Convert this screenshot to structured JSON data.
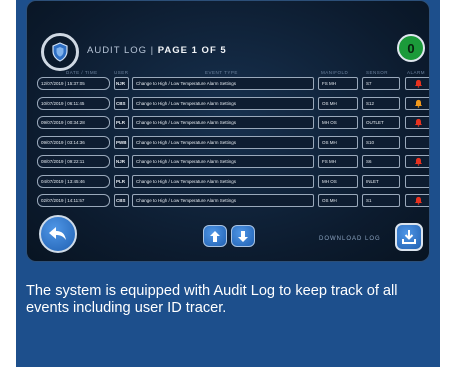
{
  "header": {
    "title_prefix": "AUDIT LOG",
    "separator": "|",
    "page_label": "PAGE 1 OF 5",
    "alert_count": "0"
  },
  "columns": {
    "datetime": "DATE / TIME",
    "user": "USER",
    "event": "EVENT TYPE",
    "manifold": "MANIFOLD",
    "sensor": "SENSOR",
    "alarm": "ALARM"
  },
  "rows": [
    {
      "datetime": "12/07/2019 | 15:37:05",
      "user": "NJR",
      "event": "Change to High / Low Temperature Alarm Settings",
      "manifold": "FS MH",
      "sensor": "S7",
      "alarm": true
    },
    {
      "datetime": "10/07/2019 | 06:11:45",
      "user": "CBS",
      "event": "Change to High / Low Temperature Alarm Settings",
      "manifold": "OS MH",
      "sensor": "S12",
      "alarm": true
    },
    {
      "datetime": "09/07/2019 | 00:34:28",
      "user": "PLR",
      "event": "Change to High / Low Temperature Alarm Settings",
      "manifold": "MH OS",
      "sensor": "OUTLET",
      "alarm": true
    },
    {
      "datetime": "09/07/2019 | 03:14:36",
      "user": "PWB",
      "event": "Change to High / Low Temperature Alarm Settings",
      "manifold": "OS MH",
      "sensor": "S10",
      "alarm": false
    },
    {
      "datetime": "08/07/2019 | 09:22:11",
      "user": "NJR",
      "event": "Change to High / Low Temperature Alarm Settings",
      "manifold": "FS MH",
      "sensor": "S6",
      "alarm": true
    },
    {
      "datetime": "04/07/2019 | 13:45:46",
      "user": "PLR",
      "event": "Change to High / Low Temperature Alarm Settings",
      "manifold": "MH OS",
      "sensor": "INLET",
      "alarm": false
    },
    {
      "datetime": "02/07/2019 | 14:11:57",
      "user": "CBS",
      "event": "Change to High / Low Temperature Alarm Settings",
      "manifold": "OS MH",
      "sensor": "S1",
      "alarm": true
    }
  ],
  "footer": {
    "download_label": "DOWNLOAD LOG"
  },
  "caption": "The system is equipped with Audit Log to keep track of all events including user ID tracer.",
  "colors": {
    "card_bg": "#1d4f8c",
    "screen_bg": "#0c1b2e",
    "button_blue": "#2f78d2",
    "badge_green": "#1b9a3a",
    "alarm_red": "#e8321f",
    "alarm_orange": "#f39a1c"
  },
  "icons": {
    "logo": "shield-icon",
    "back": "back-arrow-icon",
    "page_up": "arrow-up-icon",
    "page_down": "arrow-down-icon",
    "download": "download-icon",
    "alarm": "bell-icon"
  }
}
